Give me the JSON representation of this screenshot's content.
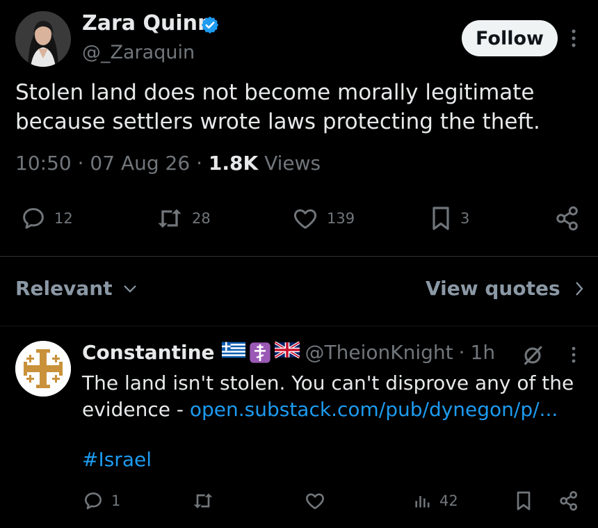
{
  "post": {
    "author_name": "Zara Quinn",
    "author_handle": "@_Zaraquin",
    "follow_label": "Follow",
    "text": "Stolen land does not become morally legitimate because settlers wrote laws protecting the theft.",
    "time": "10:50",
    "date": "07 Aug 26",
    "views_count": "1.8K",
    "views_label": "Views",
    "replies": "12",
    "reposts": "28",
    "likes": "139",
    "bookmarks": "3"
  },
  "replies_bar": {
    "sort_label": "Relevant",
    "quotes_label": "View quotes"
  },
  "reply": {
    "author_name": "Constantine",
    "author_handle": "@TheionKnight",
    "separator": "·",
    "age": "1h",
    "text": "The land isn't stolen. You can't disprove any of the evidence - ",
    "link": "open.substack.com/pub/dynegon/p/...",
    "hashtag": "#Israel",
    "replies": "1",
    "views": "42"
  },
  "colors": {
    "background": "#000000",
    "text": "#e7e9ea",
    "muted": "#71767b",
    "link": "#1d9bf0",
    "verified": "#1d9bf0"
  },
  "icons": [
    "verified-badge-icon",
    "more-icon",
    "reply-icon",
    "repost-icon",
    "like-icon",
    "bookmark-icon",
    "share-icon",
    "chevron-down-icon",
    "chevron-right-icon",
    "grok-icon",
    "views-icon",
    "greece-flag-icon",
    "orthodox-cross-icon",
    "uk-flag-icon",
    "jerusalem-cross-avatar"
  ]
}
